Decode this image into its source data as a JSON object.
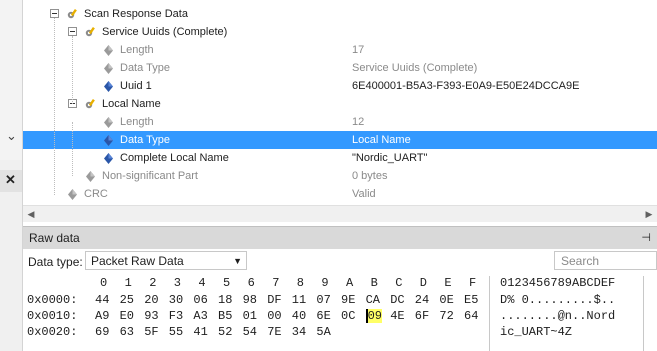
{
  "tree": {
    "rows": [
      {
        "label": "Scan Response Data",
        "value": "",
        "level": 0,
        "expander": true,
        "icon": "gear-pencil"
      },
      {
        "label": "Service Uuids (Complete)",
        "value": "",
        "level": 1,
        "expander": true,
        "icon": "gear-pencil"
      },
      {
        "label": "Length",
        "value": "17",
        "level": 2,
        "expander": false,
        "icon": "diamond",
        "dim": true
      },
      {
        "label": "Data Type",
        "value": "Service Uuids (Complete)",
        "level": 2,
        "expander": false,
        "icon": "diamond",
        "dim": true
      },
      {
        "label": "Uuid 1",
        "value": "6E400001-B5A3-F393-E0A9-E50E24DCCA9E",
        "level": 2,
        "expander": false,
        "icon": "diamond-blue"
      },
      {
        "label": "Local Name",
        "value": "",
        "level": 1,
        "expander": true,
        "icon": "gear-pencil"
      },
      {
        "label": "Length",
        "value": "12",
        "level": 2,
        "expander": false,
        "icon": "diamond",
        "dim": true
      },
      {
        "label": "Data Type",
        "value": "Local Name",
        "level": 2,
        "expander": false,
        "icon": "diamond-blue",
        "selected": true
      },
      {
        "label": "Complete Local Name",
        "value": "\"Nordic_UART\"",
        "level": 2,
        "expander": false,
        "icon": "diamond-blue"
      },
      {
        "label": "Non-significant Part",
        "value": "0 bytes",
        "level": 1,
        "expander": false,
        "icon": "diamond",
        "dim": true
      },
      {
        "label": "CRC",
        "value": "Valid",
        "level": 0,
        "expander": false,
        "icon": "diamond",
        "dim": true
      }
    ]
  },
  "raw_data": {
    "title": "Raw data",
    "pin_glyph": "⊣",
    "data_type_label": "Data type:",
    "data_type_value": "Packet Raw Data",
    "search_placeholder": "Search",
    "column_headers": [
      "0",
      "1",
      "2",
      "3",
      "4",
      "5",
      "6",
      "7",
      "8",
      "9",
      "A",
      "B",
      "C",
      "D",
      "E",
      "F"
    ],
    "ascii_header": "0123456789ABCDEF",
    "rows": [
      {
        "offset": "0x0000:",
        "bytes": [
          "44",
          "25",
          "20",
          "30",
          "06",
          "18",
          "98",
          "DF",
          "11",
          "07",
          "9E",
          "CA",
          "DC",
          "24",
          "0E",
          "E5"
        ],
        "ascii": "D% 0.........$.."
      },
      {
        "offset": "0x0010:",
        "bytes": [
          "A9",
          "E0",
          "93",
          "F3",
          "A3",
          "B5",
          "01",
          "00",
          "40",
          "6E",
          "0C",
          "09",
          "4E",
          "6F",
          "72",
          "64"
        ],
        "ascii": "........@n..Nord"
      },
      {
        "offset": "0x0020:",
        "bytes": [
          "69",
          "63",
          "5F",
          "55",
          "41",
          "52",
          "54",
          "7E",
          "34",
          "5A"
        ],
        "ascii": "ic_UART~4Z"
      }
    ],
    "highlight": {
      "row": 1,
      "col": 11,
      "color": "#ffff66"
    }
  },
  "colors": {
    "selection": "#3399ff",
    "highlight": "#ffff66",
    "offset_blue": "#1e1e1e"
  },
  "left_strip": {
    "chevron": "⌄",
    "close": "✕"
  }
}
